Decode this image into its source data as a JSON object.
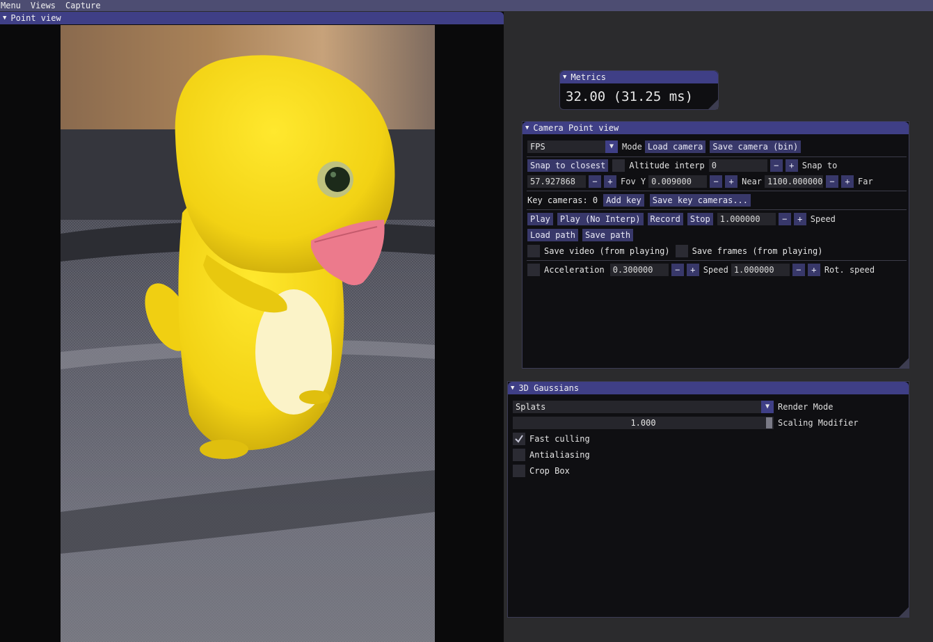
{
  "menubar": [
    "Menu",
    "Views",
    "Capture"
  ],
  "point_view": {
    "title": "Point view"
  },
  "metrics": {
    "title": "Metrics",
    "value": "32.00 (31.25 ms)"
  },
  "camera": {
    "title": "Camera Point view",
    "mode_value": "FPS",
    "mode_label": "Mode",
    "load_camera": "Load camera",
    "save_camera": "Save camera (bin)",
    "snap_to_closest": "Snap to closest",
    "altitude_label": "Altitude interp",
    "altitude_value": "0",
    "snap_to_label": "Snap to",
    "fov_value": "57.927868",
    "fov_label": "Fov Y",
    "near_value": "0.009000",
    "near_label": "Near",
    "far_value": "1100.000000",
    "far_label": "Far",
    "key_cameras": "Key cameras: 0",
    "add_key": "Add key",
    "save_key_cameras": "Save key cameras...",
    "play": "Play",
    "play_no_interp": "Play (No Interp)",
    "record": "Record",
    "stop": "Stop",
    "speed_value": "1.000000",
    "speed_label": "Speed",
    "load_path": "Load path",
    "save_path": "Save path",
    "save_video": "Save video (from playing)",
    "save_frames": "Save frames (from playing)",
    "acceleration_label": "Acceleration",
    "acceleration_value": "0.300000",
    "speed2_label": "Speed",
    "speed2_value": "1.000000",
    "rot_speed_label": "Rot. speed",
    "minus": "−",
    "plus": "+"
  },
  "gaussians": {
    "title": "3D Gaussians",
    "render_mode_value": "Splats",
    "render_mode_label": "Render Mode",
    "scaling_value": "1.000",
    "scaling_label": "Scaling Modifier",
    "fast_culling": "Fast culling",
    "fast_culling_checked": true,
    "antialiasing": "Antialiasing",
    "antialiasing_checked": false,
    "crop_box": "Crop Box",
    "crop_box_checked": false
  }
}
